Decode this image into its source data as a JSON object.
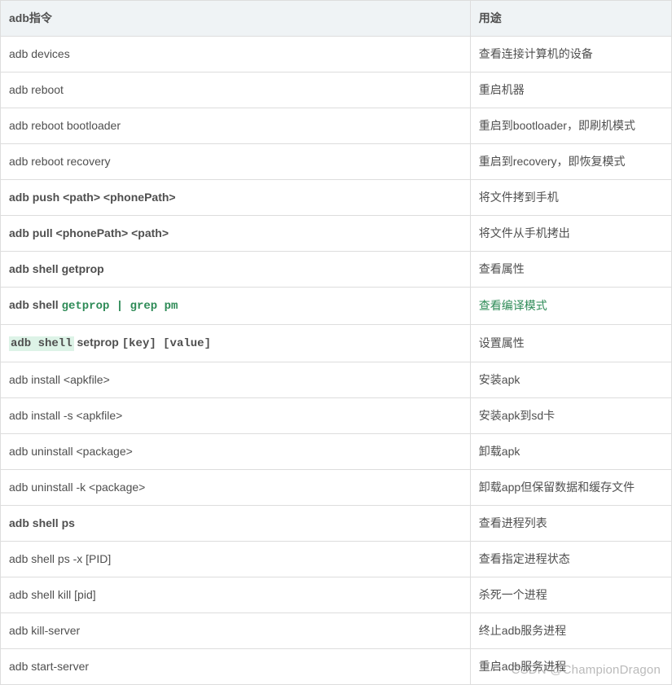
{
  "table": {
    "headers": [
      "adb指令",
      "用途"
    ],
    "rows": [
      {
        "cmd": "adb devices",
        "style": "normal",
        "desc": "查看连接计算机的设备",
        "descStyle": "normal"
      },
      {
        "cmd": "adb reboot",
        "style": "normal",
        "desc": "重启机器",
        "descStyle": "normal"
      },
      {
        "cmd": "adb reboot bootloader",
        "style": "normal",
        "desc": "重启到bootloader，即刷机模式",
        "descStyle": "normal"
      },
      {
        "cmd": "adb reboot recovery",
        "style": "normal",
        "desc": "重启到recovery，即恢复模式",
        "descStyle": "normal"
      },
      {
        "cmd": "adb push <path>  <phonePath>",
        "style": "bold",
        "desc": "将文件拷到手机",
        "descStyle": "normal"
      },
      {
        "cmd": "adb pull <phonePath>  <path>",
        "style": "bold",
        "desc": "将文件从手机拷出",
        "descStyle": "normal"
      },
      {
        "cmd": "adb shell getprop",
        "style": "bold",
        "desc": "查看属性",
        "descStyle": "normal"
      },
      {
        "pre": "adb shell ",
        "preStyle": "bold",
        "code": "getprop | grep pm",
        "codeStyle": "hl-green",
        "desc": "查看编译模式",
        "descStyle": "hl-green-text"
      },
      {
        "pre": "adb shell",
        "preStyle": "hl-bg",
        "mid": " setprop ",
        "midStyle": "bold",
        "code": "[key] [value]",
        "codeStyle": "code-bold",
        "desc": "设置属性",
        "descStyle": "normal"
      },
      {
        "cmd": "adb install <apkfile>",
        "style": "normal",
        "desc": "安装apk",
        "descStyle": "normal"
      },
      {
        "cmd": "adb install -s <apkfile>",
        "style": "normal",
        "desc": "安装apk到sd卡",
        "descStyle": "normal"
      },
      {
        "cmd": "adb uninstall <package>",
        "style": "normal",
        "desc": "卸载apk",
        "descStyle": "normal"
      },
      {
        "cmd": "adb uninstall -k <package>",
        "style": "normal",
        "desc": "卸载app但保留数据和缓存文件",
        "descStyle": "normal"
      },
      {
        "cmd": "adb shell ps",
        "style": "bold",
        "desc": "查看进程列表",
        "descStyle": "normal"
      },
      {
        "cmd": "adb shell ps -x [PID]",
        "style": "normal",
        "desc": "查看指定进程状态",
        "descStyle": "normal"
      },
      {
        "cmd": "adb shell kill [pid]",
        "style": "normal",
        "desc": "杀死一个进程",
        "descStyle": "normal"
      },
      {
        "cmd": "adb kill-server",
        "style": "normal",
        "desc": "终止adb服务进程",
        "descStyle": "normal"
      },
      {
        "cmd": "adb start-server",
        "style": "normal",
        "desc": "重启adb服务进程",
        "descStyle": "normal"
      }
    ]
  },
  "watermark": "CSDN @ChampionDragon"
}
